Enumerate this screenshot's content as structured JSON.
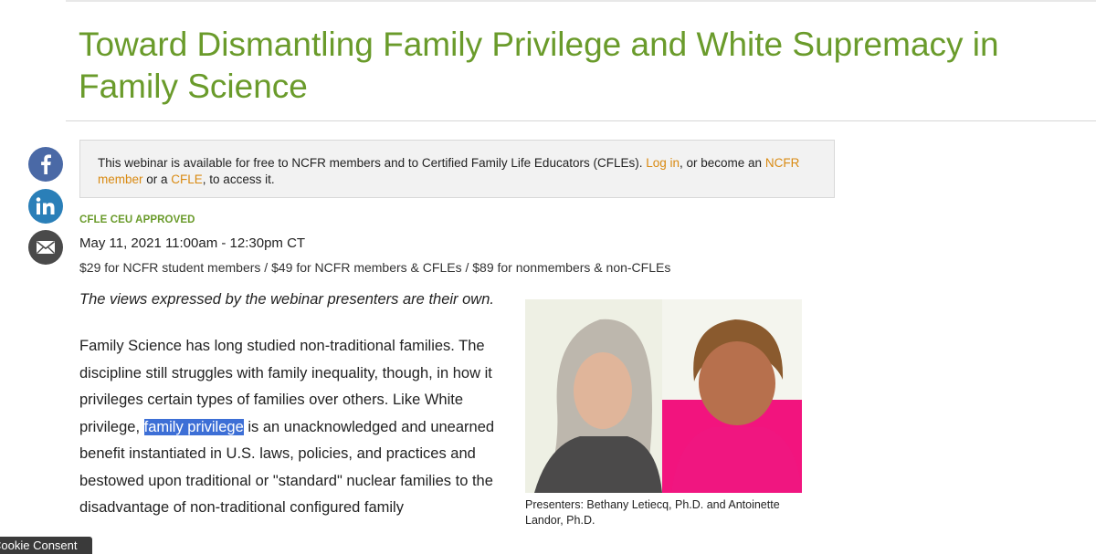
{
  "page": {
    "title": "Toward Dismantling Family Privilege and White Supremacy in Family Science"
  },
  "share": {
    "facebook_icon": "facebook-icon",
    "linkedin_icon": "linkedin-icon",
    "email_icon": "envelope-icon"
  },
  "notice": {
    "text_before": "This webinar is available for free to NCFR members and to Certified Family Life Educators (CFLEs). ",
    "login_link": "Log in",
    "text_mid1": ", or become an ",
    "member_link": "NCFR member",
    "text_mid2": " or a ",
    "cfle_link": "CFLE",
    "text_after": ", to access it."
  },
  "event": {
    "ceu_label": "CFLE CEU APPROVED",
    "date_time": "May 11, 2021 11:00am - 12:30pm CT",
    "pricing": "$29 for NCFR student members / $49 for NCFR members & CFLEs / $89 for nonmembers & non-CFLEs"
  },
  "content": {
    "disclaimer": "The views expressed by the webinar presenters are their own.",
    "para_before": "Family Science has long studied non-traditional families. The discipline still struggles with family inequality, though, in how it privileges certain types of families over others. Like White privilege, ",
    "para_highlight": "family privilege",
    "para_after": " is an unacknowledged and unearned benefit instantiated in U.S. laws, policies, and practices and bestowed upon traditional or \"standard\" nuclear families to the disadvantage of non-traditional configured family"
  },
  "photo": {
    "caption": "Presenters: Bethany Letiecq, Ph.D. and Antoinette Landor, Ph.D."
  },
  "cookie": {
    "label": "Cookie Consent"
  },
  "colors": {
    "title_green": "#6a9b2b",
    "link_orange": "#d98a12",
    "highlight_blue": "#3d6fd6"
  }
}
